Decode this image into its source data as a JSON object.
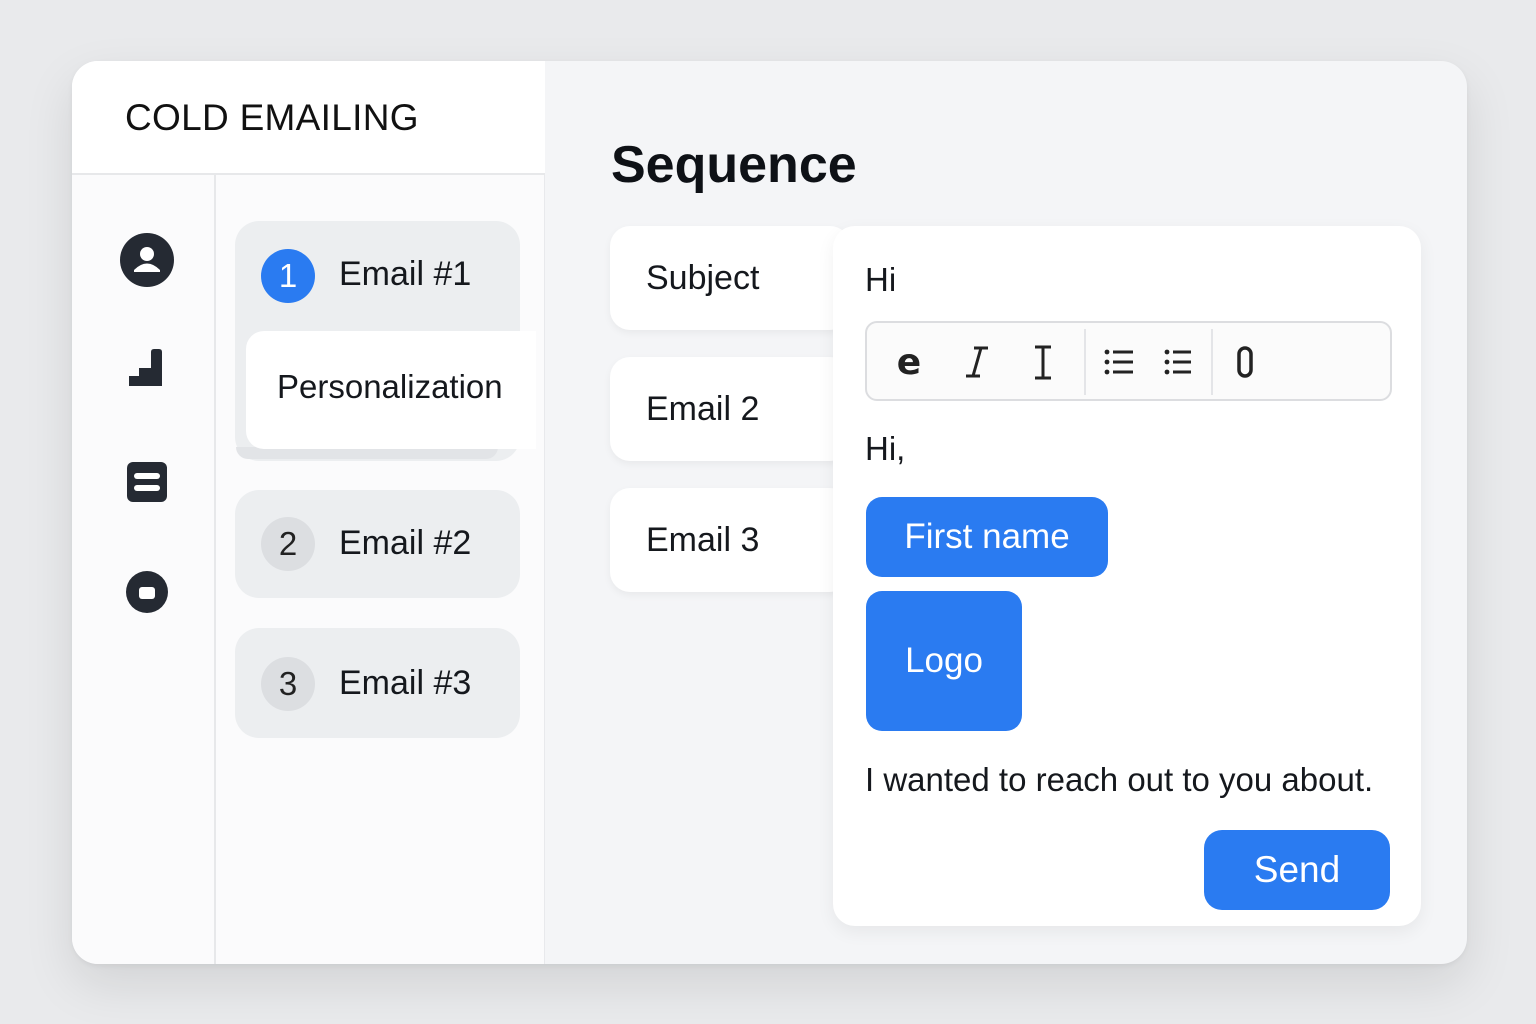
{
  "app": {
    "title": "COLD EMAILING"
  },
  "rail": {
    "icons": [
      "user-icon",
      "chart-icon",
      "document-icon",
      "stop-icon"
    ]
  },
  "steps": [
    {
      "number": "1",
      "label": "Email #1",
      "active": true
    },
    {
      "number": "2",
      "label": "Email #2",
      "active": false
    },
    {
      "number": "3",
      "label": "Email #3",
      "active": false
    }
  ],
  "substep": {
    "label": "Personalization"
  },
  "main": {
    "title": "Sequence",
    "tabs": [
      {
        "label": "Subject"
      },
      {
        "label": "Email 2"
      },
      {
        "label": "Email 3"
      }
    ]
  },
  "editor": {
    "subject_value": "Hi",
    "toolbar": [
      "bold-icon",
      "italic-icon",
      "text-cursor-icon",
      "bulleted-list-icon",
      "list-icon",
      "code-icon"
    ],
    "greeting": "Hi,",
    "first_name_tag": "First name",
    "logo_tag": "Logo",
    "body": "I wanted to reach out to you about.",
    "send_label": "Send"
  },
  "colors": {
    "accent": "#2a7bf1",
    "background": "#e9eaec",
    "panel": "#f4f5f7"
  }
}
